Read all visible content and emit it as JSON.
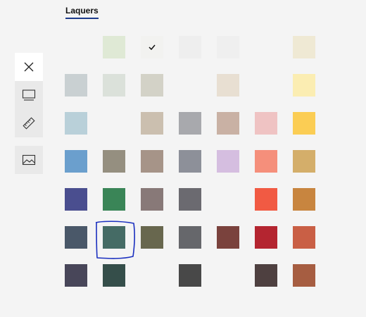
{
  "section": {
    "title": "Laquers"
  },
  "toolbar": {
    "icons": [
      "close-icon",
      "monitor-icon",
      "ruler-icon",
      "image-icon"
    ]
  },
  "colors": {
    "accent": "#1d3b8a",
    "annotation": "#1a2fbf"
  },
  "swatches": [
    {
      "row": 0,
      "col": 1,
      "color": "#dfe9d5"
    },
    {
      "row": 0,
      "col": 2,
      "color": "#f2f2f0",
      "selected": true
    },
    {
      "row": 0,
      "col": 3,
      "color": "#eeeeee"
    },
    {
      "row": 0,
      "col": 4,
      "color": "#efefef"
    },
    {
      "row": 0,
      "col": 6,
      "color": "#efe9d4"
    },
    {
      "row": 1,
      "col": 0,
      "color": "#c9d0d2"
    },
    {
      "row": 1,
      "col": 1,
      "color": "#dbe1da"
    },
    {
      "row": 1,
      "col": 2,
      "color": "#d3d2c7"
    },
    {
      "row": 1,
      "col": 4,
      "color": "#e8dfd2"
    },
    {
      "row": 1,
      "col": 6,
      "color": "#fbedb2"
    },
    {
      "row": 2,
      "col": 0,
      "color": "#b9d0d9"
    },
    {
      "row": 2,
      "col": 2,
      "color": "#cbbfaf"
    },
    {
      "row": 2,
      "col": 3,
      "color": "#a8a9ad"
    },
    {
      "row": 2,
      "col": 4,
      "color": "#c9b1a4"
    },
    {
      "row": 2,
      "col": 5,
      "color": "#efc3c3"
    },
    {
      "row": 2,
      "col": 6,
      "color": "#fbcd54"
    },
    {
      "row": 3,
      "col": 0,
      "color": "#6b9fcd"
    },
    {
      "row": 3,
      "col": 1,
      "color": "#958f80"
    },
    {
      "row": 3,
      "col": 2,
      "color": "#a69488"
    },
    {
      "row": 3,
      "col": 3,
      "color": "#8d9099"
    },
    {
      "row": 3,
      "col": 4,
      "color": "#d5bee0"
    },
    {
      "row": 3,
      "col": 5,
      "color": "#f58f7b"
    },
    {
      "row": 3,
      "col": 6,
      "color": "#d4ae6a"
    },
    {
      "row": 4,
      "col": 0,
      "color": "#4a4e8f"
    },
    {
      "row": 4,
      "col": 1,
      "color": "#3a8557"
    },
    {
      "row": 4,
      "col": 2,
      "color": "#887978"
    },
    {
      "row": 4,
      "col": 3,
      "color": "#6b6a70"
    },
    {
      "row": 4,
      "col": 5,
      "color": "#f15a43"
    },
    {
      "row": 4,
      "col": 6,
      "color": "#c8853f"
    },
    {
      "row": 5,
      "col": 0,
      "color": "#4a5869"
    },
    {
      "row": 5,
      "col": 1,
      "color": "#456b65"
    },
    {
      "row": 5,
      "col": 2,
      "color": "#68674e"
    },
    {
      "row": 5,
      "col": 3,
      "color": "#66676b"
    },
    {
      "row": 5,
      "col": 4,
      "color": "#7a423d"
    },
    {
      "row": 5,
      "col": 5,
      "color": "#b42530"
    },
    {
      "row": 5,
      "col": 6,
      "color": "#c95f45"
    },
    {
      "row": 6,
      "col": 0,
      "color": "#484659"
    },
    {
      "row": 6,
      "col": 1,
      "color": "#354e4a"
    },
    {
      "row": 6,
      "col": 3,
      "color": "#484848"
    },
    {
      "row": 6,
      "col": 5,
      "color": "#4e4040"
    },
    {
      "row": 6,
      "col": 6,
      "color": "#a65d41"
    }
  ]
}
